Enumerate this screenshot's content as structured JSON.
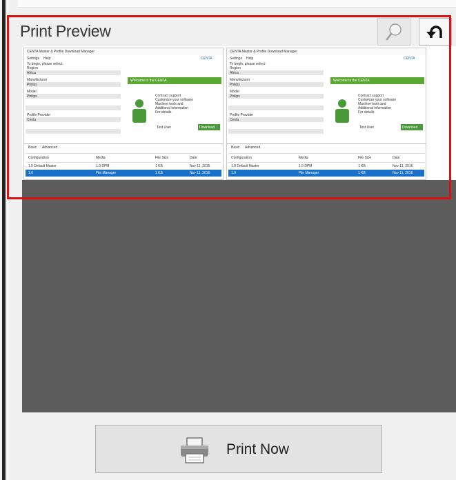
{
  "panel": {
    "title": "Print Preview"
  },
  "toolbar": {
    "search_icon": "magnifier-icon",
    "undo_icon": "undo-arrow-icon"
  },
  "preview": {
    "pages": [
      {
        "window_title": "CENTA Master & Profile Download Manager",
        "menu": [
          "Settings",
          "Help"
        ],
        "brand": "CENTA",
        "instruction": "To begin, please select:",
        "fields": [
          "Region",
          "Manufacturer",
          "Model",
          "Profile Provider"
        ],
        "field_values": [
          "Africa",
          "Philips",
          "Philips",
          "Centa"
        ],
        "banner": "Welcome to the CENTA",
        "info_lines": [
          "Contract support",
          "Customize your software",
          "Machine tools and",
          "Additional information",
          "For details"
        ],
        "user_label": "Test User",
        "button": "Download",
        "tabs": [
          "Basic",
          "Advanced"
        ],
        "table_headers": [
          "Configuration",
          "Media",
          "File Size",
          "Date"
        ],
        "table_rows": [
          [
            "1.0 Default Master",
            "1.0 DPM",
            "1 KB",
            "Nov 11, 2016"
          ],
          [
            "1.0",
            "File Manager",
            "1 KB",
            "Nov 11, 2016"
          ]
        ]
      },
      {
        "window_title": "CENTA Master & Profile Download Manager",
        "menu": [
          "Settings",
          "Help"
        ],
        "brand": "CENTA",
        "instruction": "To begin, please select:",
        "fields": [
          "Region",
          "Manufacturer",
          "Model",
          "Profile Provider"
        ],
        "field_values": [
          "Africa",
          "Philips",
          "Philips",
          "Centa"
        ],
        "banner": "Welcome to the CENTA",
        "info_lines": [
          "Contract support",
          "Customize your software",
          "Machine tools and",
          "Additional information",
          "For details"
        ],
        "user_label": "Test User",
        "button": "Download",
        "tabs": [
          "Basic",
          "Advanced"
        ],
        "table_headers": [
          "Configuration",
          "Media",
          "File Size",
          "Date"
        ],
        "table_rows": [
          [
            "1.0 Default Master",
            "1.0 DPM",
            "1 KB",
            "Nov 11, 2016"
          ],
          [
            "1.0",
            "File Manager",
            "1 KB",
            "Nov 11, 2016"
          ]
        ]
      }
    ]
  },
  "print": {
    "label": "Print Now",
    "icon": "printer-icon"
  },
  "colors": {
    "highlight": "#e01010",
    "preview_background": "#5c5c5c",
    "thumb_accent": "#5aa832",
    "thumb_selection": "#1a70c8"
  }
}
